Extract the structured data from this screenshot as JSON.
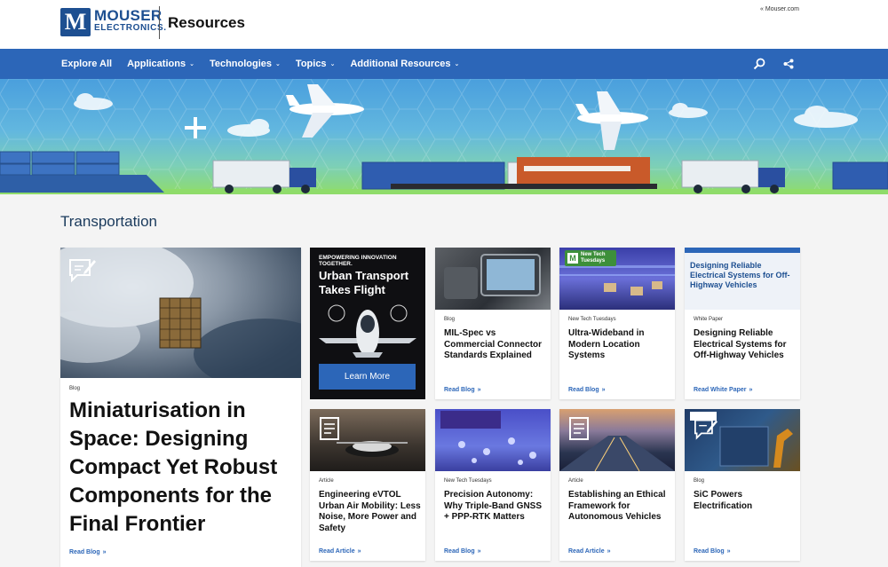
{
  "header": {
    "logo_line1": "MOUSER",
    "logo_line2": "ELECTRONICS.",
    "logo_mark": "M",
    "site_title": "Resources",
    "external_link": "« Mouser.com"
  },
  "nav": {
    "items": [
      {
        "label": "Explore All",
        "dropdown": false
      },
      {
        "label": "Applications",
        "dropdown": true
      },
      {
        "label": "Technologies",
        "dropdown": true
      },
      {
        "label": "Topics",
        "dropdown": true
      },
      {
        "label": "Additional Resources",
        "dropdown": true
      }
    ],
    "icons": [
      "search-icon",
      "share-icon"
    ],
    "color": "#2c66b8"
  },
  "page": {
    "section_title": "Transportation"
  },
  "feature": {
    "category": "Blog",
    "title": "Miniaturisation in Space: Designing Compact Yet Robust Components for the Final Frontier",
    "link": "Read Blog"
  },
  "ad": {
    "tagline": "EMPOWERING INNOVATION TOGETHER.",
    "title": "Urban Transport Takes Flight",
    "button": "Learn More"
  },
  "cards": [
    {
      "category": "Blog",
      "title": "MIL-Spec vs Commercial Connector Standards Explained",
      "link": "Read Blog"
    },
    {
      "category": "New Tech Tuesdays",
      "title": "Ultra-Wideband in Modern Location Systems",
      "link": "Read Blog",
      "badge": "New Tech Tuesdays"
    },
    {
      "category": "White Paper",
      "title": "Designing Reliable Electrical Systems for Off-Highway Vehicles",
      "link": "Read White Paper",
      "image_title": "Designing Reliable Electrical Systems for Off-Highway Vehicles"
    },
    {
      "category": "Article",
      "title": "Engineering eVTOL Urban Air Mobility: Less Noise, More Power and Safety",
      "link": "Read Article"
    },
    {
      "category": "New Tech Tuesdays",
      "title": "Precision Autonomy: Why Triple-Band GNSS + PPP-RTK Matters",
      "link": "Read Blog"
    },
    {
      "category": "Article",
      "title": "Establishing an Ethical Framework for Autonomous Vehicles",
      "link": "Read Article"
    },
    {
      "category": "Blog",
      "title": "SiC Powers Electrification",
      "link": "Read Blog"
    }
  ]
}
